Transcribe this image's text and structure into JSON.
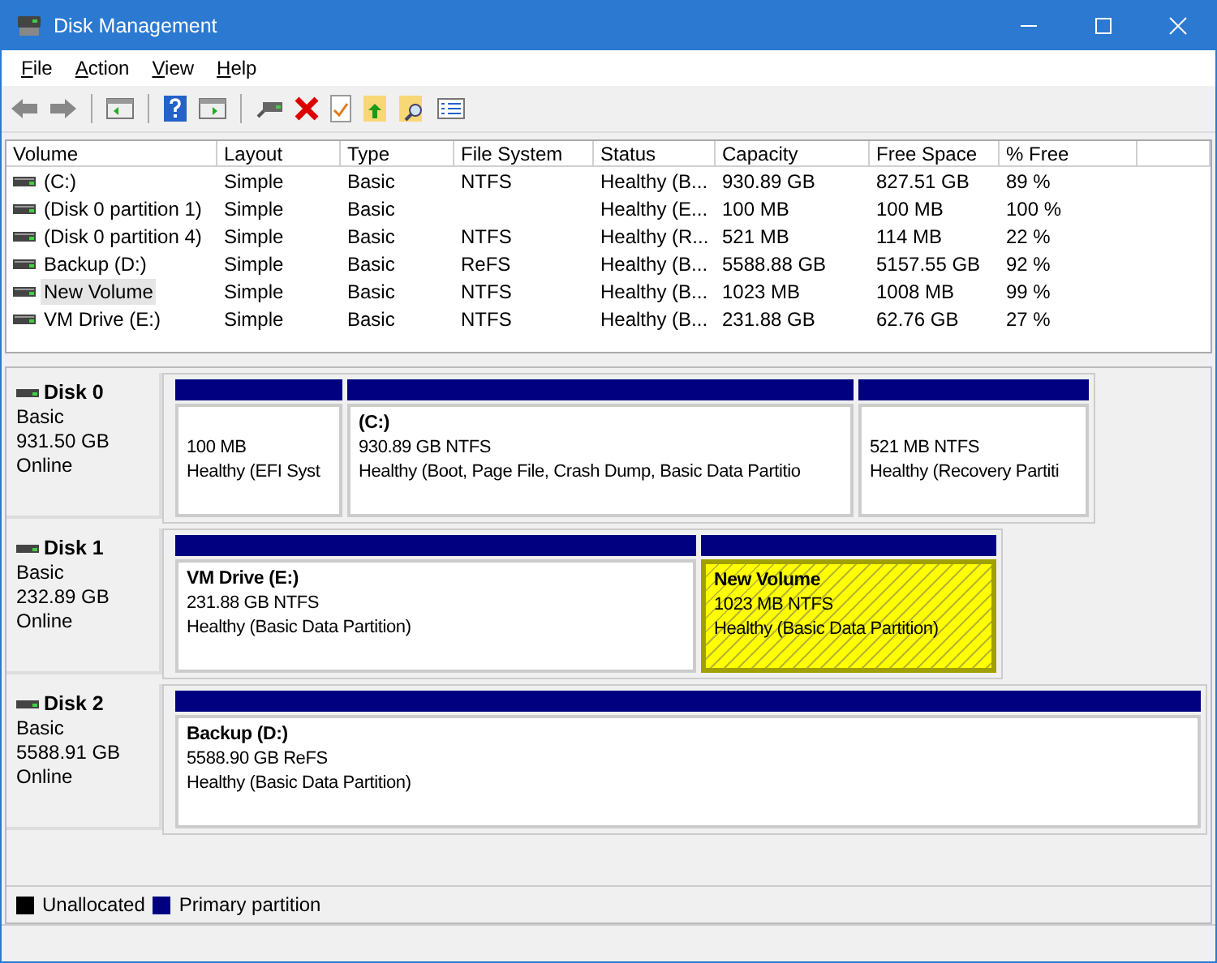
{
  "window": {
    "title": "Disk Management"
  },
  "menu": [
    {
      "label": "F",
      "rest": "ile"
    },
    {
      "label": "A",
      "rest": "ction"
    },
    {
      "label": "V",
      "rest": "iew"
    },
    {
      "label": "H",
      "rest": "elp"
    }
  ],
  "table": {
    "columns": [
      "Volume",
      "Layout",
      "Type",
      "File System",
      "Status",
      "Capacity",
      "Free Space",
      "% Free"
    ],
    "rows": [
      {
        "cells": [
          " (C:)",
          "Simple",
          "Basic",
          "NTFS",
          "Healthy (B...",
          "930.89 GB",
          "827.51 GB",
          "89 %"
        ],
        "selected": false
      },
      {
        "cells": [
          "(Disk 0 partition 1)",
          "Simple",
          "Basic",
          "",
          "Healthy (E...",
          "100 MB",
          "100 MB",
          "100 %"
        ],
        "selected": false
      },
      {
        "cells": [
          "(Disk 0 partition 4)",
          "Simple",
          "Basic",
          "NTFS",
          "Healthy (R...",
          "521 MB",
          "114 MB",
          "22 %"
        ],
        "selected": false
      },
      {
        "cells": [
          "Backup (D:)",
          "Simple",
          "Basic",
          "ReFS",
          "Healthy (B...",
          "5588.88 GB",
          "5157.55 GB",
          "92 %"
        ],
        "selected": false
      },
      {
        "cells": [
          "New Volume",
          "Simple",
          "Basic",
          "NTFS",
          "Healthy (B...",
          "1023 MB",
          "1008 MB",
          "99 %"
        ],
        "selected": true
      },
      {
        "cells": [
          "VM Drive (E:)",
          "Simple",
          "Basic",
          "NTFS",
          "Healthy (B...",
          "231.88 GB",
          "62.76 GB",
          "27 %"
        ],
        "selected": false
      }
    ]
  },
  "disks": [
    {
      "name": "Disk 0",
      "type": "Basic",
      "size": "931.50 GB",
      "state": "Online",
      "partitions": [
        {
          "size": "100 MB",
          "status": "Healthy (EFI Syst",
          "selected": false
        },
        {
          "name": " (C:)",
          "size": "930.89 GB NTFS",
          "status": "Healthy (Boot, Page File, Crash Dump, Basic Data Partitio",
          "selected": false
        },
        {
          "size": "521 MB NTFS",
          "status": "Healthy (Recovery Partiti",
          "selected": false
        }
      ]
    },
    {
      "name": "Disk 1",
      "type": "Basic",
      "size": "232.89 GB",
      "state": "Online",
      "partitions": [
        {
          "name": "VM Drive  (E:)",
          "size": "231.88 GB NTFS",
          "status": "Healthy (Basic Data Partition)",
          "selected": false
        },
        {
          "name": "New Volume",
          "size": "1023 MB NTFS",
          "status": "Healthy (Basic Data Partition)",
          "selected": true
        }
      ]
    },
    {
      "name": "Disk 2",
      "type": "Basic",
      "size": "5588.91 GB",
      "state": "Online",
      "partitions": [
        {
          "name": "Backup  (D:)",
          "size": "5588.90 GB ReFS",
          "status": "Healthy (Basic Data Partition)",
          "selected": false
        }
      ]
    }
  ],
  "legend": [
    {
      "label": "Unallocated",
      "color": "#000000"
    },
    {
      "label": "Primary partition",
      "color": "#000080"
    }
  ]
}
